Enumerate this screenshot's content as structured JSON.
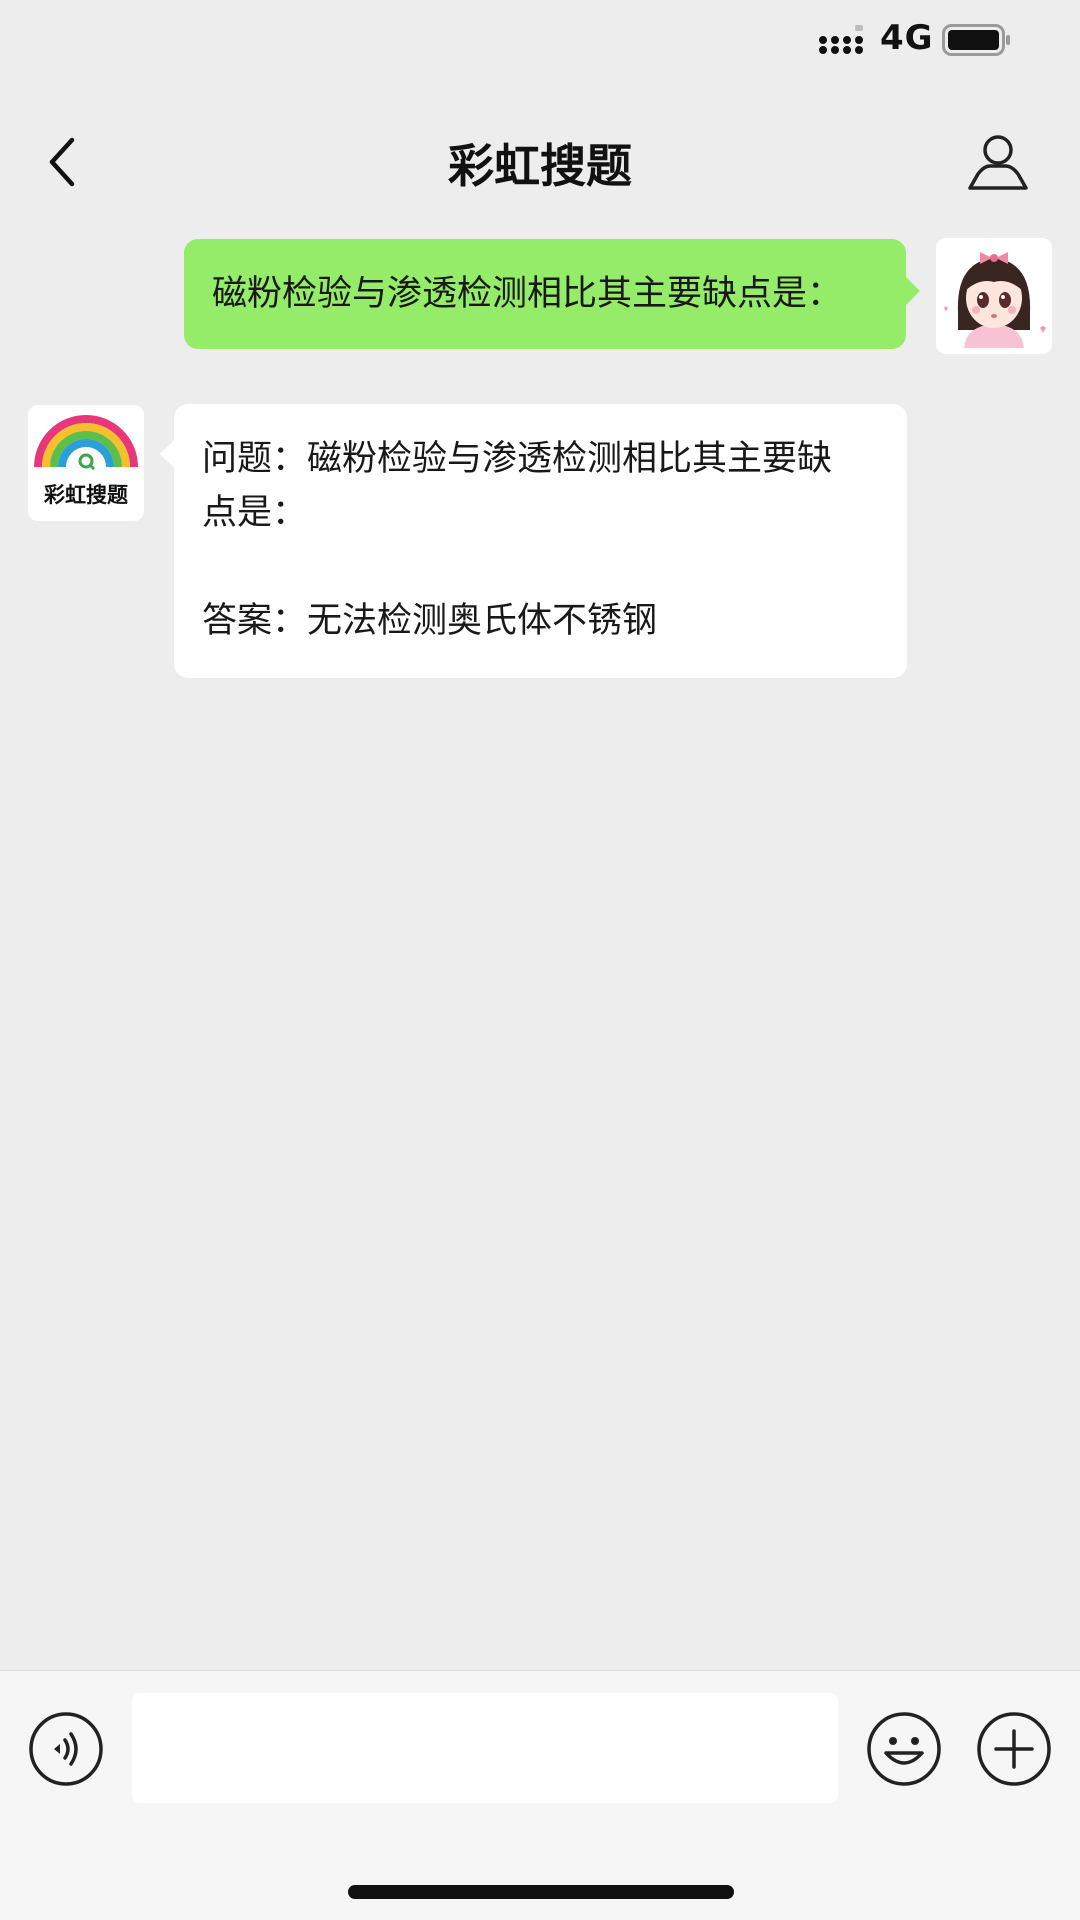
{
  "status_bar": {
    "network": "4G"
  },
  "nav": {
    "title": "彩虹搜题"
  },
  "messages": {
    "user_text": "磁粉检验与渗透检测相比其主要缺点是：",
    "bot_logo_text": "彩虹搜题",
    "bot_line1": "问题：磁粉检验与渗透检测相比其主要缺",
    "bot_line2": "点是：",
    "bot_line3": "答案：无法检测奥氏体不锈钢"
  },
  "input": {
    "value": ""
  },
  "colors": {
    "user_bubble": "#95ec69",
    "background": "#ededed",
    "bot_bubble": "#ffffff"
  },
  "icons": [
    "signal-icon",
    "battery-icon",
    "back-arrow-icon",
    "profile-icon",
    "voice-icon",
    "emoji-icon",
    "plus-icon"
  ]
}
